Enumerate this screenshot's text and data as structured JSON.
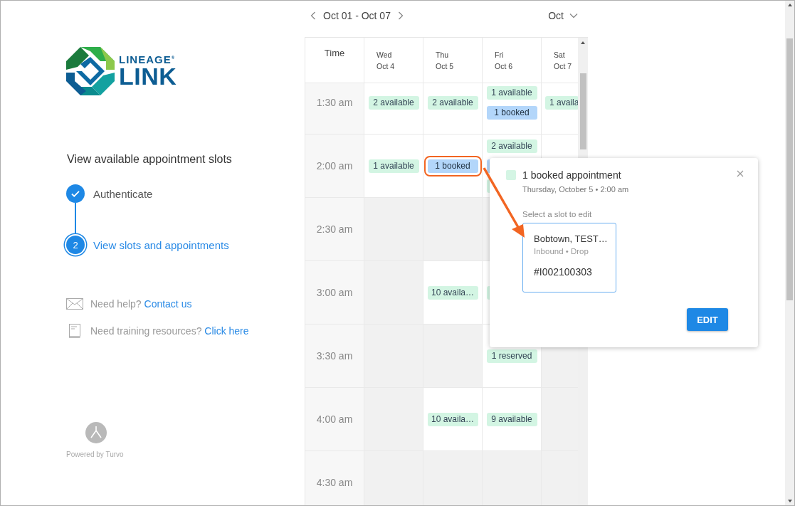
{
  "brand": {
    "name": "LINEAGE$^{®}$",
    "sub": "LINK"
  },
  "sidebar": {
    "heading": "View available appointment slots",
    "steps": [
      {
        "label": "Authenticate",
        "completed": true,
        "selected": false
      },
      {
        "label": "View slots and appointments",
        "number": "2",
        "completed": false,
        "selected": true
      }
    ],
    "help": [
      {
        "kind": "mail",
        "text": "Need help?",
        "link": "Contact us"
      },
      {
        "kind": "book",
        "text": "Need training resources?",
        "link": "Click here"
      }
    ],
    "powered_by": "Powered by Turvo"
  },
  "calendar": {
    "range": "Oct 01 - Oct 07",
    "month": "Oct",
    "time_header": "Time",
    "columns": [
      {
        "day": "Wed",
        "date": "Oct 4"
      },
      {
        "day": "Thu",
        "date": "Oct 5"
      },
      {
        "day": "Fri",
        "date": "Oct 6"
      },
      {
        "day": "Sat",
        "date": "Oct 7"
      }
    ],
    "rows": [
      {
        "time": "1:30 am",
        "cells": [
          {
            "open": true,
            "chips": [
              {
                "label": "2 available",
                "kind": "available"
              }
            ]
          },
          {
            "open": true,
            "chips": [
              {
                "label": "2 available",
                "kind": "available"
              }
            ]
          },
          {
            "open": true,
            "chips": [
              {
                "label": "1 available",
                "kind": "available"
              },
              {
                "label": "1 booked",
                "kind": "booked"
              }
            ]
          },
          {
            "open": true,
            "chips": [
              {
                "label": "1 availa",
                "kind": "available"
              }
            ]
          }
        ]
      },
      {
        "time": "2:00 am",
        "cells": [
          {
            "open": true,
            "chips": [
              {
                "label": "1 available",
                "kind": "available"
              }
            ]
          },
          {
            "open": true,
            "chips": [
              {
                "label": "1 booked",
                "kind": "booked",
                "highlighted": true
              }
            ]
          },
          {
            "open": true,
            "chips": [
              {
                "label": "2 available",
                "kind": "available"
              },
              {
                "kind": "booked"
              },
              {
                "kind": "available"
              }
            ]
          },
          {}
        ]
      },
      {
        "time": "2:30 am",
        "cells": [
          {
            "open": false
          },
          {
            "open": false
          },
          {
            "open": false
          },
          {}
        ]
      },
      {
        "time": "3:00 am",
        "cells": [
          {
            "open": false
          },
          {
            "open": true,
            "chips": [
              {
                "label": "10 availa…",
                "kind": "available"
              }
            ]
          },
          {
            "open": true,
            "chips": [
              {
                "kind": "available"
              }
            ]
          },
          {}
        ]
      },
      {
        "time": "3:30 am",
        "cells": [
          {
            "open": false
          },
          {
            "open": false
          },
          {
            "open": true,
            "chips": [
              {
                "label": "1 reserved",
                "kind": "available"
              }
            ]
          },
          {
            "open": false
          }
        ]
      },
      {
        "time": "4:00 am",
        "cells": [
          {
            "open": false
          },
          {
            "open": true,
            "chips": [
              {
                "label": "10 availa…",
                "kind": "available"
              }
            ]
          },
          {
            "open": true,
            "chips": [
              {
                "label": "9 available",
                "kind": "available"
              }
            ]
          },
          {
            "open": false
          }
        ]
      },
      {
        "time": "4:30 am",
        "cells": [
          {
            "open": false
          },
          {
            "open": false
          },
          {
            "open": false
          },
          {
            "open": false
          }
        ]
      }
    ]
  },
  "popover": {
    "title": "1 booked appointment",
    "color": "#d4f5e4",
    "subtitle": "Thursday, October 5 • 2:00 am",
    "prompt": "Select a slot to edit",
    "slots": [
      {
        "title": "Bobtown, TEST…",
        "meta": "Inbound • Drop",
        "number": "#I002100303",
        "selected": true
      }
    ],
    "button": "EDIT"
  }
}
